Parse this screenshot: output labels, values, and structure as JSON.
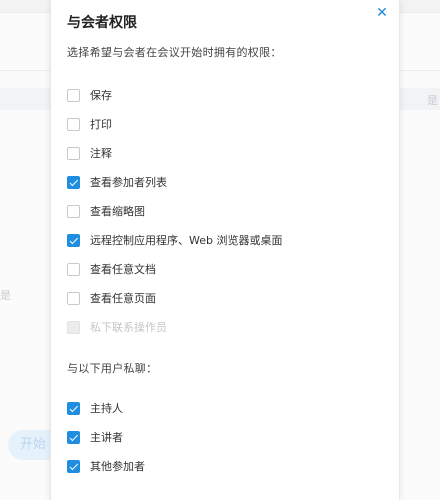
{
  "background": {
    "left_text": "是",
    "right_text": "是",
    "pill_label": "开始"
  },
  "dialog": {
    "title": "与会者权限",
    "subtitle": "选择希望与会者在会议开始时拥有的权限：",
    "permissions": [
      {
        "label": "保存",
        "checked": false,
        "disabled": false
      },
      {
        "label": "打印",
        "checked": false,
        "disabled": false
      },
      {
        "label": "注释",
        "checked": false,
        "disabled": false
      },
      {
        "label": "查看参加者列表",
        "checked": true,
        "disabled": false
      },
      {
        "label": "查看缩略图",
        "checked": false,
        "disabled": false
      },
      {
        "label": "远程控制应用程序、Web 浏览器或桌面",
        "checked": true,
        "disabled": false
      },
      {
        "label": "查看任意文档",
        "checked": false,
        "disabled": false
      },
      {
        "label": "查看任意页面",
        "checked": false,
        "disabled": false
      },
      {
        "label": "私下联系操作员",
        "checked": false,
        "disabled": true
      }
    ],
    "chat_section_title": "与以下用户私聊：",
    "chat_targets": [
      {
        "label": "主持人",
        "checked": true
      },
      {
        "label": "主讲者",
        "checked": true
      },
      {
        "label": "其他参加者",
        "checked": true
      }
    ]
  },
  "colors": {
    "accent": "#1f8ee0",
    "close_icon": "#1e88d8"
  }
}
